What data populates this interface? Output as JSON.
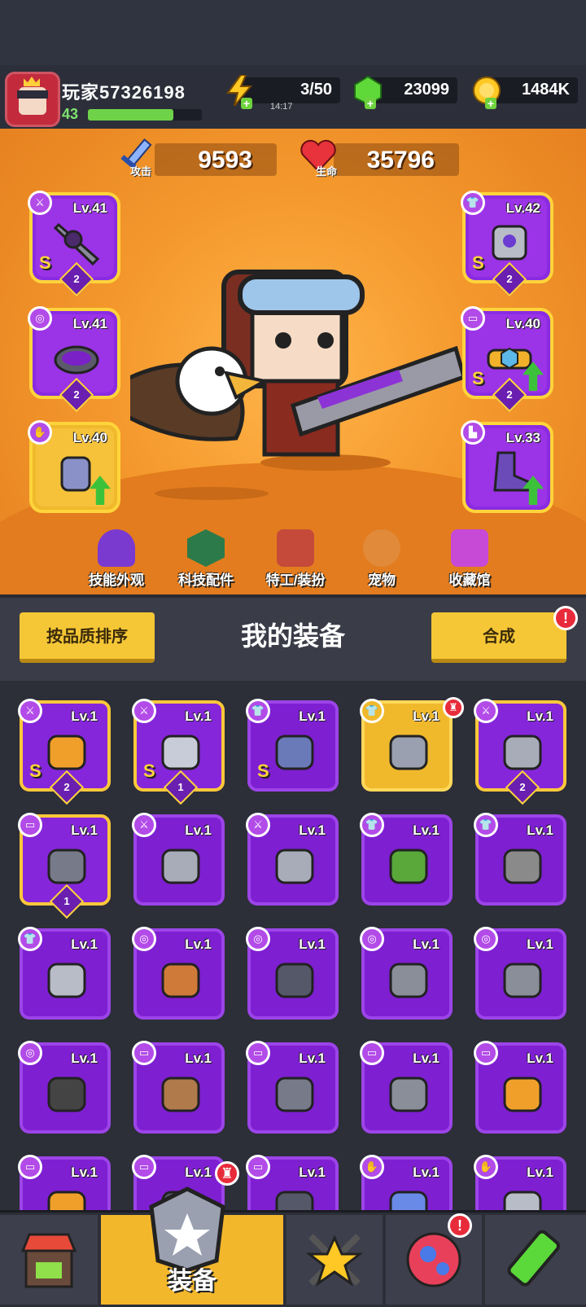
{
  "player": {
    "name": "玩家57326198",
    "level": "43",
    "xp_fraction": 0.75
  },
  "resources": {
    "energy": {
      "value": "3/50",
      "timer": "14:17"
    },
    "gems": {
      "value": "23099"
    },
    "gold": {
      "value": "1484K"
    }
  },
  "stats": {
    "attack": {
      "label": "攻击",
      "value": "9593"
    },
    "hp": {
      "label": "生命",
      "value": "35796"
    }
  },
  "equipped": [
    {
      "slot": "weapon",
      "icon": "weapon-icon",
      "level": "Lv.41",
      "rank": "S",
      "stars": "2",
      "upgrade": false
    },
    {
      "slot": "armor",
      "icon": "armor-icon",
      "level": "Lv.42",
      "rank": "S",
      "stars": "2",
      "upgrade": false
    },
    {
      "slot": "necklace",
      "icon": "necklace-icon",
      "level": "Lv.41",
      "rank": "",
      "stars": "2",
      "upgrade": false
    },
    {
      "slot": "belt",
      "icon": "belt-icon",
      "level": "Lv.40",
      "rank": "S",
      "stars": "2",
      "upgrade": true
    },
    {
      "slot": "glove",
      "icon": "glove-icon",
      "level": "Lv.40",
      "rank": "",
      "stars": "",
      "upgrade": true
    },
    {
      "slot": "boots",
      "icon": "boots-icon",
      "level": "Lv.33",
      "rank": "",
      "stars": "",
      "upgrade": true
    }
  ],
  "menu": [
    {
      "label": "技能外观",
      "icon": "skill-skin-icon"
    },
    {
      "label": "科技配件",
      "icon": "tech-part-icon"
    },
    {
      "label": "特工/装扮",
      "icon": "agent-costume-icon"
    },
    {
      "label": "宠物",
      "icon": "pet-icon"
    },
    {
      "label": "收藏馆",
      "icon": "collection-icon"
    }
  ],
  "toolbar": {
    "sort_label": "按品质排序",
    "title": "我的装备",
    "merge_label": "合成",
    "merge_alert": "!"
  },
  "items": [
    {
      "type": "weapon",
      "level": "Lv.1",
      "rank": "S",
      "stars": "2",
      "gold": true,
      "art": "sword"
    },
    {
      "type": "weapon",
      "level": "Lv.1",
      "rank": "S",
      "stars": "1",
      "gold": true,
      "art": "gun"
    },
    {
      "type": "armor",
      "level": "Lv.1",
      "rank": "S",
      "stars": "",
      "gold": false,
      "art": "mech-armor"
    },
    {
      "type": "armor",
      "level": "Lv.1",
      "rank": "",
      "stars": "",
      "gold": false,
      "yellow": true,
      "art": "vest",
      "badge": true
    },
    {
      "type": "weapon",
      "level": "Lv.1",
      "rank": "",
      "stars": "2",
      "gold": true,
      "art": "kunai"
    },
    {
      "type": "belt",
      "level": "Lv.1",
      "rank": "",
      "stars": "1",
      "gold": true,
      "art": "belt-star"
    },
    {
      "type": "weapon",
      "level": "Lv.1",
      "rank": "",
      "stars": "",
      "art": "kunai"
    },
    {
      "type": "weapon",
      "level": "Lv.1",
      "rank": "",
      "stars": "",
      "art": "kunai"
    },
    {
      "type": "armor",
      "level": "Lv.1",
      "rank": "",
      "stars": "",
      "art": "leaf-armor"
    },
    {
      "type": "armor",
      "level": "Lv.1",
      "rank": "",
      "stars": "",
      "art": "stone-armor"
    },
    {
      "type": "armor",
      "level": "Lv.1",
      "rank": "",
      "stars": "",
      "art": "plate-armor"
    },
    {
      "type": "necklace",
      "level": "Lv.1",
      "rank": "",
      "stars": "",
      "art": "fang-necklace"
    },
    {
      "type": "necklace",
      "level": "Lv.1",
      "rank": "",
      "stars": "",
      "art": "spike-collar"
    },
    {
      "type": "necklace",
      "level": "Lv.1",
      "rank": "",
      "stars": "",
      "art": "gem-necklace"
    },
    {
      "type": "necklace",
      "level": "Lv.1",
      "rank": "",
      "stars": "",
      "art": "gem-necklace"
    },
    {
      "type": "necklace",
      "level": "Lv.1",
      "rank": "",
      "stars": "",
      "art": "tag-necklace"
    },
    {
      "type": "belt",
      "level": "Lv.1",
      "rank": "",
      "stars": "",
      "art": "rope-belt"
    },
    {
      "type": "belt",
      "level": "Lv.1",
      "rank": "",
      "stars": "",
      "art": "belt-star"
    },
    {
      "type": "belt",
      "level": "Lv.1",
      "rank": "",
      "stars": "",
      "art": "gem-belt"
    },
    {
      "type": "belt",
      "level": "Lv.1",
      "rank": "",
      "stars": "",
      "art": "hex-belt"
    },
    {
      "type": "belt",
      "level": "Lv.1",
      "rank": "",
      "stars": "",
      "art": "hex-belt"
    },
    {
      "type": "belt",
      "level": "Lv.1",
      "rank": "",
      "stars": "",
      "art": "belt"
    },
    {
      "type": "belt",
      "level": "Lv.1",
      "rank": "",
      "stars": "",
      "art": "belt"
    },
    {
      "type": "glove",
      "level": "Lv.1",
      "rank": "",
      "stars": "",
      "art": "claw-glove"
    },
    {
      "type": "glove",
      "level": "Lv.1",
      "rank": "",
      "stars": "",
      "art": "tech-glove"
    }
  ],
  "nav": [
    {
      "label": "",
      "icon": "shop-icon",
      "active": false
    },
    {
      "label": "装备",
      "icon": "equipment-icon",
      "active": true
    },
    {
      "label": "",
      "icon": "battle-icon",
      "active": false
    },
    {
      "label": "",
      "icon": "planet-icon",
      "active": false,
      "alert": "!"
    },
    {
      "label": "",
      "icon": "lab-icon",
      "active": false
    }
  ],
  "colors": {
    "epic": "#8a2be2",
    "gold": "#ffd43b",
    "arena": "#f59a2e",
    "button": "#f5c736",
    "alert": "#e82b3a"
  }
}
